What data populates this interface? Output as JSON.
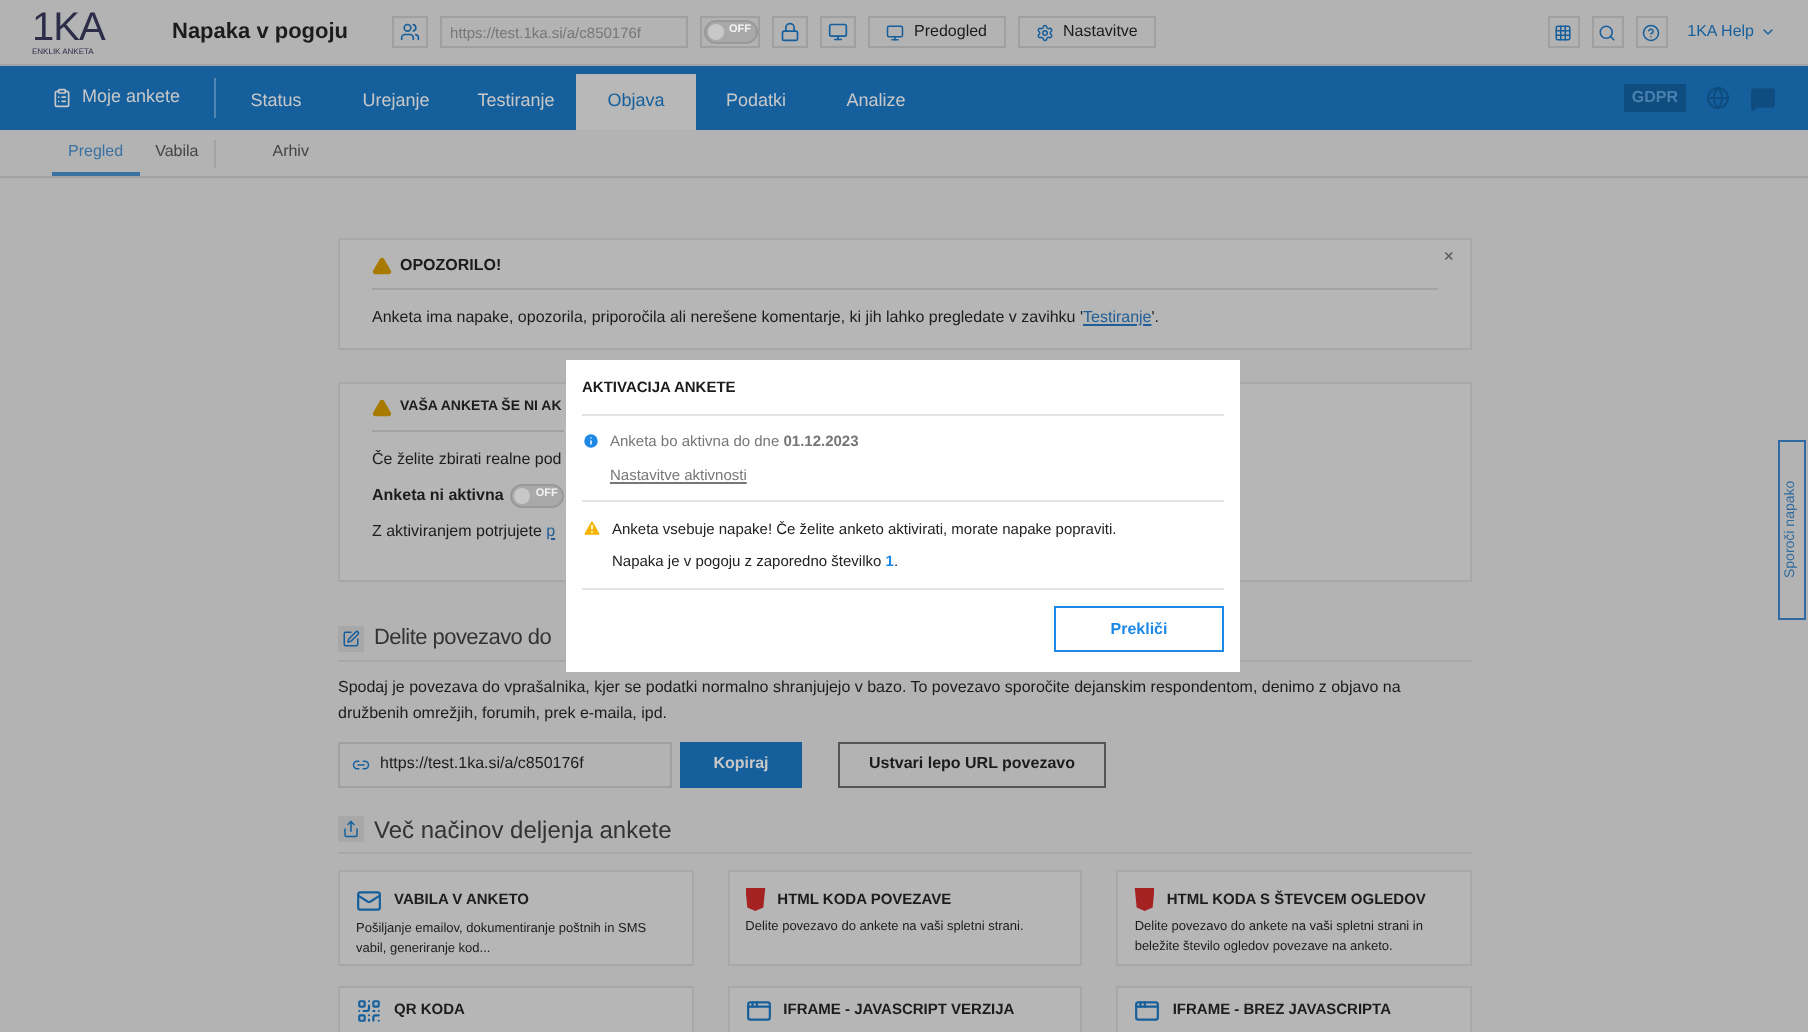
{
  "header": {
    "logo": "1KA",
    "logo_subtitle": "ENKLIK ANKETA",
    "survey_title": "Napaka v pogoju",
    "url": "https://test.1ka.si/a/c850176f",
    "toggle": {
      "label": "OFF",
      "on": false
    },
    "preview_button": "Predogled",
    "settings_button": "Nastavitve",
    "help_menu": "1KA Help"
  },
  "nav": {
    "home": "Moje ankete",
    "tabs": [
      {
        "label": "Status",
        "selected": false
      },
      {
        "label": "Urejanje",
        "selected": false
      },
      {
        "label": "Testiranje",
        "selected": false
      },
      {
        "label": "Objava",
        "selected": true
      },
      {
        "label": "Podatki",
        "selected": false
      },
      {
        "label": "Analize",
        "selected": false
      }
    ],
    "gdpr": "GDPR"
  },
  "subtabs": [
    {
      "label": "Pregled",
      "selected": true
    },
    {
      "label": "Vabila",
      "selected": false
    },
    {
      "label": "Arhiv",
      "selected": false
    }
  ],
  "warning_card": {
    "title": "OPOZORILO!",
    "close": "×",
    "text_before": "Anketa ima napake, opozorila, priporočila ali nerešene komentarje, ki jih lahko pregledate v zavihku '",
    "link": "Testiranje",
    "text_after": "'."
  },
  "status_card": {
    "title": "VAŠA ANKETA ŠE NI AK",
    "text": "Če želite zbirati realne pod",
    "toggle_label": "Anketa ni aktivna",
    "toggle": {
      "label": "OFF",
      "on": false
    },
    "confirm_text": "Z aktiviranjem potrjujete",
    "confirm_link": "p"
  },
  "share": {
    "title": "Delite povezavo do",
    "description": "Spodaj je povezava do vprašalnika, kjer se podatki normalno shranjujejo v bazo. To povezavo sporočite dejanskim respondentom, denimo z objavo na družbenih omrežjih, forumih, prek e-maila, ipd.",
    "url": "https://test.1ka.si/a/c850176f",
    "copy_button": "Kopiraj",
    "pretty_url_button": "Ustvari lepo URL povezavo"
  },
  "more": {
    "title": "Več načinov deljenja ankete",
    "cards": [
      {
        "kind": "mail",
        "title": "VABILA V ANKETO",
        "text": "Pošiljanje emailov, dokumentiranje poštnih in SMS vabil, generiranje kod..."
      },
      {
        "kind": "html",
        "title": "HTML KODA POVEZAVE",
        "text": "Delite povezavo do ankete na vaši spletni strani."
      },
      {
        "kind": "html",
        "title": "HTML KODA S ŠTEVCEM OGLEDOV",
        "text": "Delite povezavo do ankete na vaši spletni strani in beležite število ogledov povezave na anketo."
      },
      {
        "kind": "qr",
        "title": "QR KODA"
      },
      {
        "kind": "window",
        "title": "IFRAME - JAVASCRIPT VERZIJA"
      },
      {
        "kind": "window",
        "title": "IFRAME - BREZ JAVASCRIPTA"
      }
    ]
  },
  "report_tab": "Sporoči napako",
  "dialog": {
    "title": "AKTIVACIJA ANKETE",
    "info": "Anketa bo aktivna do dne **01.12.2023**",
    "info_link": "Nastavitve aktivnosti",
    "warning": "Anketa vsebuje napake! Če želite anketo aktivirati, morate napake popraviti.",
    "error_before": "Napaka je v pogoju z zaporedno številko ",
    "error_link": "1",
    "error_after": ".",
    "cancel_button": "Prekliči"
  }
}
